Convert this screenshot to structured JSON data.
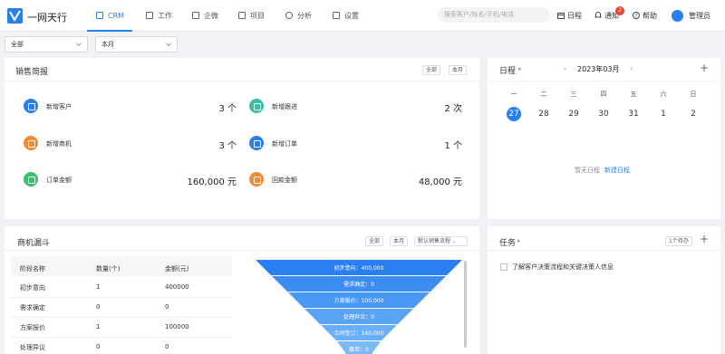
{
  "header": {
    "brand": "一网天行",
    "nav": [
      {
        "label": "CRM",
        "icon": "grid-icon"
      },
      {
        "label": "工作",
        "icon": "calendar-icon"
      },
      {
        "label": "企微",
        "icon": "wechat-icon"
      },
      {
        "label": "项目",
        "icon": "project-icon"
      },
      {
        "label": "分析",
        "icon": "pie-icon"
      },
      {
        "label": "设置",
        "icon": "monitor-icon"
      }
    ],
    "search_placeholder": "搜索客户/姓名/手机/电话",
    "schedule": "日程",
    "notify": "通知",
    "notify_count": "2",
    "help": "帮助",
    "user": "管理员"
  },
  "filters": {
    "scope": "全部",
    "period": "本月"
  },
  "sales_report": {
    "title": "销售简报",
    "chip_all": "全部",
    "chip_month": "本月",
    "stats": [
      {
        "label": "新增客户",
        "value": "3 个",
        "color": "#2a7ff0"
      },
      {
        "label": "新增跟进",
        "value": "2 次",
        "color": "#3bbfa3"
      },
      {
        "label": "新增商机",
        "value": "3 个",
        "color": "#f08c35"
      },
      {
        "label": "新增订单",
        "value": "1 个",
        "color": "#2a7ff0"
      },
      {
        "label": "订单金额",
        "value": "160,000 元",
        "color": "#3cbf6f"
      },
      {
        "label": "回款金额",
        "value": "48,000 元",
        "color": "#f08c35"
      }
    ]
  },
  "calendar": {
    "title": "日程",
    "month": "2023年03月",
    "weekdays": [
      "一",
      "二",
      "三",
      "四",
      "五",
      "六",
      "日"
    ],
    "days": [
      "27",
      "28",
      "29",
      "30",
      "31",
      "1",
      "2"
    ],
    "empty_text": "暂无日程",
    "new_link": "新建日程",
    "add_symbol": "+"
  },
  "funnel": {
    "title": "商机漏斗",
    "chip_all": "全部",
    "chip_month": "本月",
    "process": "默认销售流程",
    "columns": [
      "阶段名称",
      "数量(个)",
      "金额(元)"
    ],
    "rows": [
      [
        "初步意向",
        "1",
        "400000"
      ],
      [
        "需求确定",
        "0",
        "0"
      ],
      [
        "方案报价",
        "1",
        "100000"
      ],
      [
        "处理异议",
        "0",
        "0"
      ]
    ],
    "chart_labels": [
      "初步意向：400,000",
      "需求确定：0",
      "方案报价：100,000",
      "处理异议：0",
      "合同签订：160,000",
      "赢单：0"
    ]
  },
  "tasks": {
    "title": "任务",
    "pending": "1个待办",
    "add_symbol": "+",
    "items": [
      "了解客户决策流程和关键决策人信息"
    ]
  },
  "colors": {
    "accent": "#2a7ff0",
    "badge": "#f04134",
    "funnel": [
      "#2a7ff0",
      "#3b8cf3",
      "#4a98f5",
      "#5aa4f7",
      "#69aff8",
      "#7bbaf9"
    ]
  }
}
